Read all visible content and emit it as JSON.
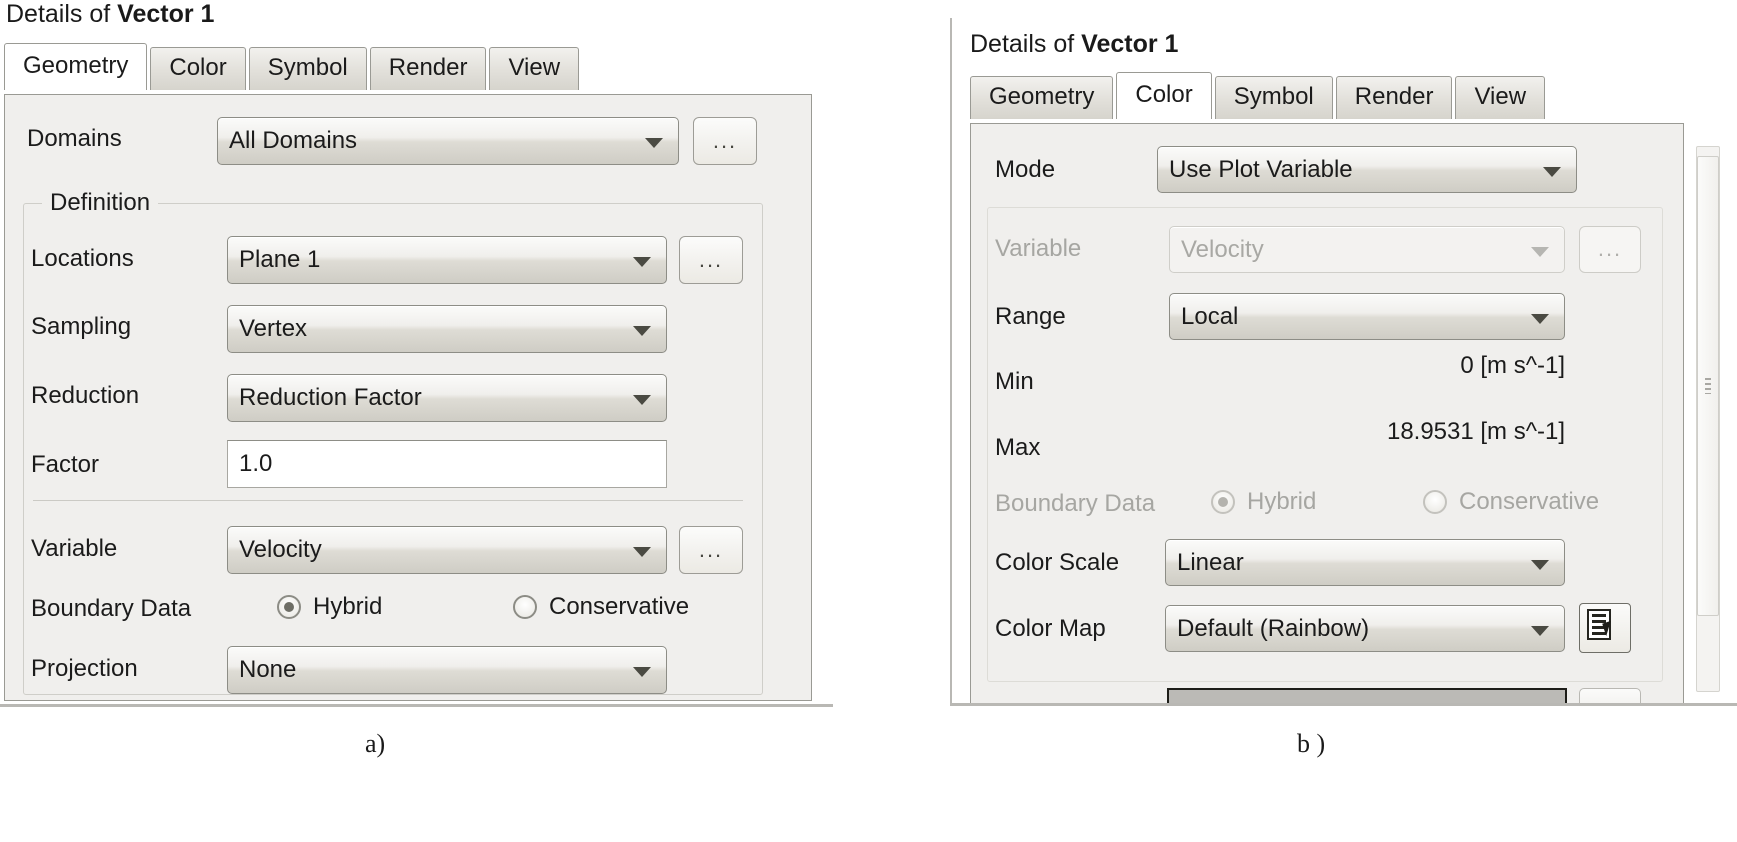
{
  "figure": {
    "caption_a": "a)",
    "caption_b": "b )"
  },
  "panel_a": {
    "title_prefix": "Details of ",
    "title_object": "Vector 1",
    "tabs": [
      {
        "label": "Geometry",
        "active": true
      },
      {
        "label": "Color",
        "active": false
      },
      {
        "label": "Symbol",
        "active": false
      },
      {
        "label": "Render",
        "active": false
      },
      {
        "label": "View",
        "active": false
      }
    ],
    "domains": {
      "label": "Domains",
      "value": "All Domains",
      "browse_label": "..."
    },
    "definition": {
      "group_title": "Definition",
      "locations": {
        "label": "Locations",
        "value": "Plane 1",
        "browse_label": "..."
      },
      "sampling": {
        "label": "Sampling",
        "value": "Vertex"
      },
      "reduction": {
        "label": "Reduction",
        "value": "Reduction Factor"
      },
      "factor": {
        "label": "Factor",
        "value": "1.0"
      },
      "variable": {
        "label": "Variable",
        "value": "Velocity",
        "browse_label": "..."
      },
      "boundary_data": {
        "label": "Boundary Data",
        "options": [
          {
            "label": "Hybrid",
            "selected": true
          },
          {
            "label": "Conservative",
            "selected": false
          }
        ]
      },
      "projection": {
        "label": "Projection",
        "value": "None"
      }
    }
  },
  "panel_b": {
    "title_prefix": "Details of ",
    "title_object": "Vector 1",
    "tabs": [
      {
        "label": "Geometry",
        "active": false
      },
      {
        "label": "Color",
        "active": true
      },
      {
        "label": "Symbol",
        "active": false
      },
      {
        "label": "Render",
        "active": false
      },
      {
        "label": "View",
        "active": false
      }
    ],
    "mode": {
      "label": "Mode",
      "value": "Use Plot Variable"
    },
    "variable": {
      "label": "Variable",
      "value": "Velocity",
      "browse_label": "...",
      "disabled": true
    },
    "range": {
      "label": "Range",
      "value": "Local"
    },
    "min": {
      "label": "Min",
      "value": "0 [m s^-1]"
    },
    "max": {
      "label": "Max",
      "value": "18.9531 [m s^-1]"
    },
    "boundary_data": {
      "label": "Boundary Data",
      "disabled": true,
      "options": [
        {
          "label": "Hybrid",
          "selected": true
        },
        {
          "label": "Conservative",
          "selected": false
        }
      ]
    },
    "color_scale": {
      "label": "Color Scale",
      "value": "Linear"
    },
    "color_map": {
      "label": "Color Map",
      "value": "Default (Rainbow)",
      "editor_icon": "colormap-editor-icon"
    }
  }
}
